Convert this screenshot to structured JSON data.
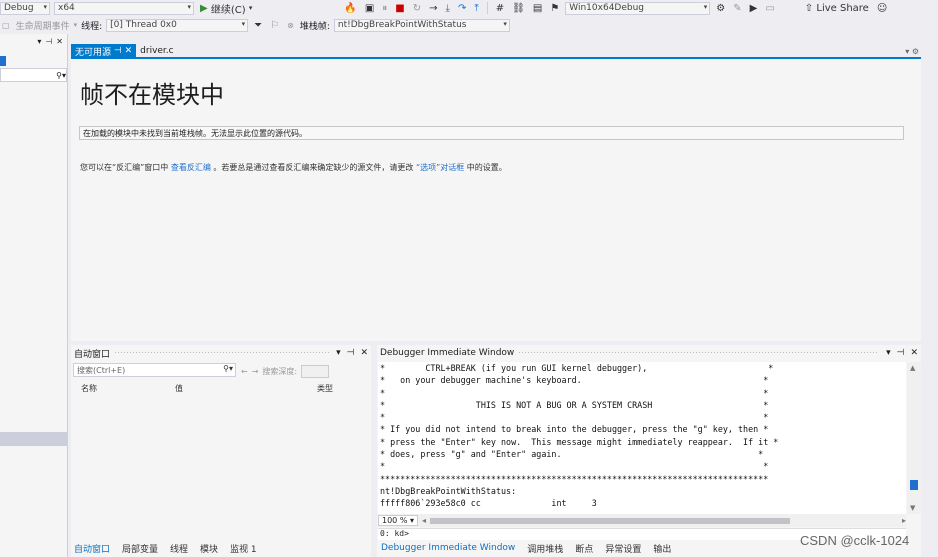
{
  "toolbar1": {
    "config": "Debug",
    "platform": "x64",
    "continue_label": "继续(C)",
    "target": "Win10x64Debug",
    "live_share": "Live Share"
  },
  "toolbar2": {
    "lifecycle_label": "生命周期事件",
    "thread_label": "线程:",
    "thread_value": "[0] Thread 0x0",
    "stackframe_label": "堆栈帧:",
    "stackframe_value": "nt!DbgBreakPointWithStatus"
  },
  "doc_tabs": [
    {
      "label": "无可用源",
      "active": true
    },
    {
      "label": "driver.c",
      "active": false
    }
  ],
  "document": {
    "title": "帧不在模块中",
    "message": "在加载的模块中未找到当前堆栈帧。无法显示此位置的源代码。",
    "hint_prefix": "您可以在“反汇编”窗口中",
    "hint_link1": "查看反汇编",
    "hint_mid": "。若要总是通过查看反汇编来确定缺少的源文件，请更改",
    "hint_link2": "“选项”对话框",
    "hint_suffix": "中的设置。"
  },
  "autos": {
    "title": "自动窗口",
    "search_placeholder": "搜索(Ctrl+E)",
    "search_depth": "搜索深度:",
    "columns": [
      "名称",
      "值",
      "类型"
    ]
  },
  "left_bottom_tabs": [
    {
      "label": "自动窗口",
      "active": true
    },
    {
      "label": "局部变量",
      "active": false
    },
    {
      "label": "线程",
      "active": false
    },
    {
      "label": "模块",
      "active": false
    },
    {
      "label": "监视 1",
      "active": false
    }
  ],
  "immediate": {
    "title": "Debugger Immediate Window",
    "lines": [
      "*        CTRL+BREAK (if you run GUI kernel debugger),                        *",
      "*   on your debugger machine's keyboard.                                    *",
      "*                                                                           *",
      "*                  THIS IS NOT A BUG OR A SYSTEM CRASH                      *",
      "*                                                                           *",
      "* If you did not intend to break into the debugger, press the \"g\" key, then *",
      "* press the \"Enter\" key now.  This message might immediately reappear.  If it *",
      "* does, press \"g\" and \"Enter\" again.                                       *",
      "*                                                                           *",
      "*****************************************************************************",
      "nt!DbgBreakPointWithStatus:",
      "fffff806`293e58c0 cc              int     3"
    ],
    "zoom": "100 %",
    "prompt": "0: kd>"
  },
  "right_bottom_tabs": [
    {
      "label": "Debugger Immediate Window",
      "active": true
    },
    {
      "label": "调用堆栈",
      "active": false
    },
    {
      "label": "断点",
      "active": false
    },
    {
      "label": "异常设置",
      "active": false
    },
    {
      "label": "输出",
      "active": false
    }
  ],
  "watermark": "CSDN @cclk-1024"
}
